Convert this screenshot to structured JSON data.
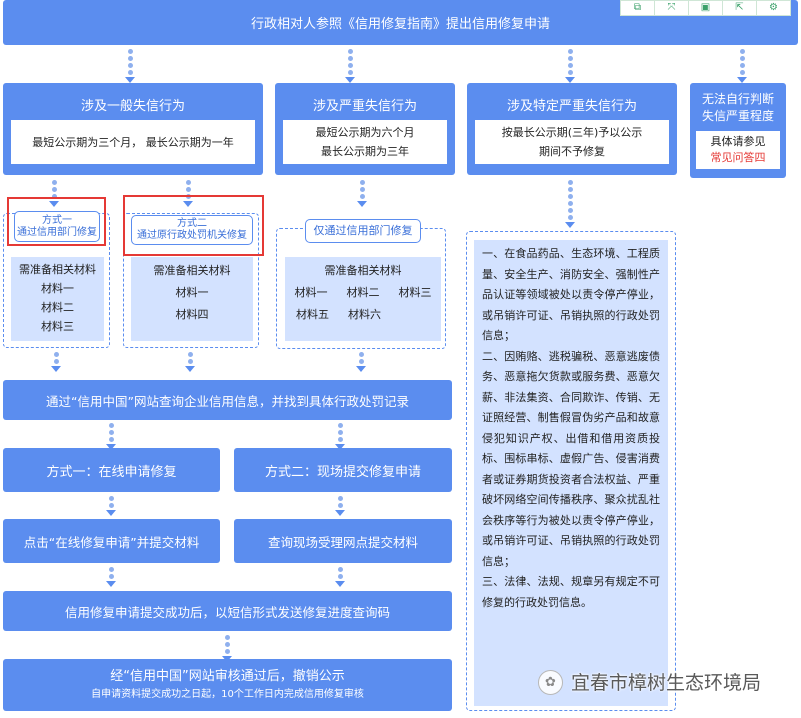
{
  "top_bar": {
    "text": "行政相对人参照《信用修复指南》提出信用修复申请"
  },
  "toolbar": {
    "icons": [
      "copy-icon",
      "shuffle-icon",
      "save-icon",
      "export-icon",
      "gear-icon"
    ],
    "glyphs": [
      "⧉",
      "⤧",
      "▣",
      "⇱",
      "⚙"
    ]
  },
  "general": {
    "title": "涉及一般失信行为",
    "desc": "最短公示期为三个月， 最长公示期为一年",
    "method1": {
      "line1": "方式一",
      "line2": "通过信用部门修复",
      "mat_title": "需准备相关材料",
      "items": [
        "材料一",
        "材料二",
        "材料三"
      ]
    },
    "method2": {
      "line1": "方式二",
      "line2": "通过原行政处罚机关修复",
      "mat_title": "需准备相关材料",
      "items": [
        "材料一",
        "材料四"
      ]
    }
  },
  "serious": {
    "title": "涉及严重失信行为",
    "desc_lines": [
      "最短公示期为六个月",
      "最长公示期为三年"
    ],
    "label": "仅通过信用部门修复",
    "mat_title": "需准备相关材料",
    "row1": [
      "材料一",
      "材料二",
      "材料三"
    ],
    "row2": [
      "材料五",
      "材料六"
    ]
  },
  "special": {
    "title": "涉及特定严重失信行为",
    "desc_lines": [
      "按最长公示期(三年)予以公示",
      "期间不予修复"
    ],
    "rules": [
      "一、在食品药品、生态环境、工程质量、安全生产、消防安全、强制性产品认证等领域被处以责令停产停业，或吊销许可证、吊销执照的行政处罚信息；",
      "二、因贿赂、逃税骗税、恶意逃废债务、恶意拖欠货款或服务费、恶意欠薪、非法集资、合同欺诈、传销、无证照经营、制售假冒伪劣产品和故意侵犯知识产权、出借和借用资质投标、围标串标、虚假广告、侵害消费者或证券期货投资者合法权益、严重破坏网络空间传播秩序、聚众扰乱社会秩序等行为被处以责令停产停业，或吊销许可证、吊销执照的行政处罚信息；",
      "三、法律、法规、规章另有规定不可修复的行政处罚信息。"
    ]
  },
  "unknown": {
    "title_lines": [
      "无法自行判断",
      "失信严重程度"
    ],
    "hint": "具体请参见",
    "link": "常见问答四"
  },
  "query_bar": {
    "text": "通过“信用中国”网站查询企业信用信息，并找到具体行政处罚记录"
  },
  "method_online": {
    "title": "方式一：在线申请修复",
    "step": "点击“在线修复申请”并提交材料"
  },
  "method_onsite": {
    "title": "方式二：现场提交修复申请",
    "step": "查询现场受理网点提交材料"
  },
  "sms_bar": {
    "text": "信用修复申请提交成功后，以短信形式发送修复进度查询码"
  },
  "final_bar": {
    "line1": "经“信用中国”网站审核通过后，撤销公示",
    "line2": "自申请资料提交成功之日起，10个工作日内完成信用修复审核"
  },
  "watermark": {
    "text": "宜春市樟树生态环境局"
  },
  "colors": {
    "primary": "#5b8def",
    "light": "#d3e2ff",
    "highlight": "#e53935",
    "link": "#e53935"
  }
}
